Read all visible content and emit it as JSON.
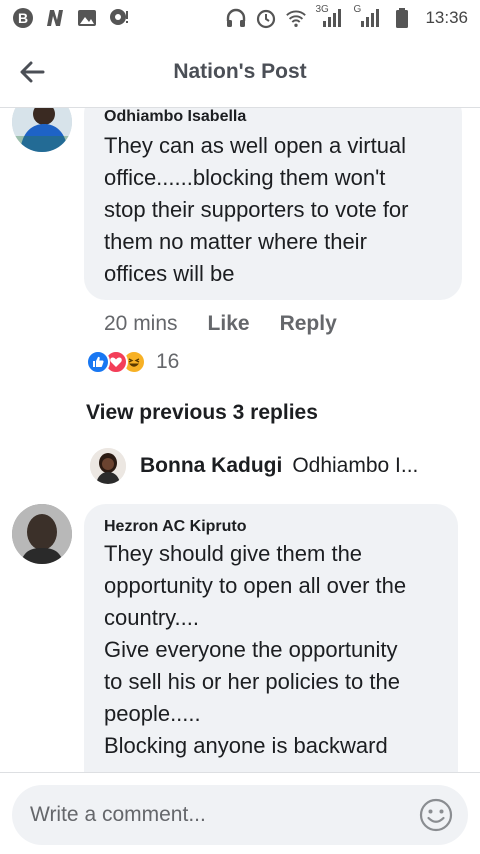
{
  "status_bar": {
    "time": "13:36",
    "network_labels": [
      "3G",
      "G"
    ]
  },
  "header": {
    "title": "Nation's Post"
  },
  "comment1": {
    "author": "Odhiambo Isabella",
    "lines": [
      "They can as well open a virtual",
      "office......blocking them won't",
      "stop their supporters to vote for",
      "them no matter where their",
      "offices will be"
    ],
    "time": "20 mins",
    "like_label": "Like",
    "reply_label": "Reply",
    "reaction_count": "16",
    "reactions": [
      "like",
      "love",
      "haha"
    ]
  },
  "view_previous": "View previous 3 replies",
  "reply_preview": {
    "author": "Bonna Kadugi",
    "snippet": "Odhiambo I..."
  },
  "comment2": {
    "author": "Hezron AC Kipruto",
    "lines": [
      "They should give them the",
      "opportunity to open all over the",
      "country....",
      "Give everyone the opportunity",
      "to sell his or her policies to the",
      "people.....",
      "Blocking anyone is backward"
    ]
  },
  "composer": {
    "placeholder": "Write a comment..."
  },
  "colors": {
    "bubble": "#f0f2f5",
    "like_blue": "#1877f2",
    "love_red": "#f33e58",
    "haha_yellow": "#f7b125",
    "secondary_text": "#65676b"
  }
}
